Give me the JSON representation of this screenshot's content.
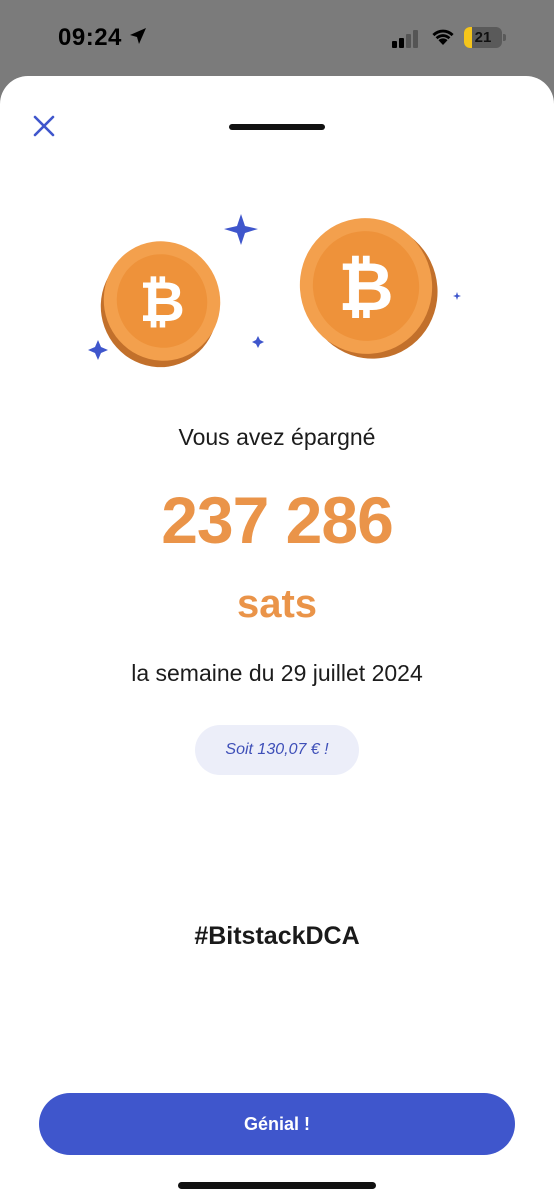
{
  "status_bar": {
    "time": "09:24",
    "battery_level": "21",
    "battery_fraction": 0.21,
    "icons": [
      "location-arrow-icon",
      "cellular-signal-icon",
      "wifi-icon",
      "battery-charging-icon"
    ]
  },
  "sheet": {
    "lead_text": "Vous avez épargné",
    "amount": "237 286",
    "unit": "sats",
    "week_text": "la semaine du 29 juillet 2024",
    "fiat_equivalent": "Soit 130,07 € !",
    "hashtag": "#BitstackDCA",
    "cta_label": "Génial !"
  },
  "colors": {
    "accent_orange": "#ea9449",
    "primary_blue": "#3f56cc",
    "pill_background": "#eceef9"
  }
}
